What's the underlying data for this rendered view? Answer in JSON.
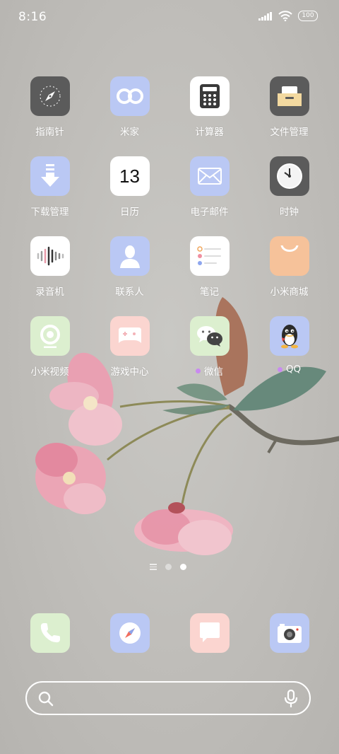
{
  "status_bar": {
    "time": "8:16",
    "battery": "100",
    "icons": [
      "signal-icon",
      "wifi-icon",
      "battery-icon"
    ]
  },
  "apps": [
    {
      "label": "指南针",
      "icon": "compass-icon"
    },
    {
      "label": "米家",
      "icon": "mijia-icon"
    },
    {
      "label": "计算器",
      "icon": "calculator-icon"
    },
    {
      "label": "文件管理",
      "icon": "file-manager-icon"
    },
    {
      "label": "下载管理",
      "icon": "download-icon"
    },
    {
      "label": "日历",
      "icon": "calendar-icon",
      "day": "13"
    },
    {
      "label": "电子邮件",
      "icon": "email-icon"
    },
    {
      "label": "时钟",
      "icon": "clock-icon"
    },
    {
      "label": "录音机",
      "icon": "recorder-icon"
    },
    {
      "label": "联系人",
      "icon": "contacts-icon"
    },
    {
      "label": "笔记",
      "icon": "notes-icon"
    },
    {
      "label": "小米商城",
      "icon": "mi-store-icon"
    },
    {
      "label": "小米视频",
      "icon": "mi-video-icon"
    },
    {
      "label": "游戏中心",
      "icon": "game-center-icon"
    },
    {
      "label": "微信",
      "icon": "wechat-icon",
      "new_dot": true
    },
    {
      "label": "QQ",
      "icon": "qq-icon",
      "new_dot": true
    }
  ],
  "page_indicator": {
    "pages": 2,
    "current": 2
  },
  "dock": [
    {
      "icon": "phone-icon"
    },
    {
      "icon": "browser-icon"
    },
    {
      "icon": "messages-icon"
    },
    {
      "icon": "camera-icon"
    }
  ],
  "search_bar": {
    "icons": [
      "search-icon",
      "mic-icon"
    ]
  },
  "colors": {
    "tile_blue": "#bac8f4",
    "tile_dark": "#5b5b5b",
    "tile_white": "#ffffff",
    "tile_green": "#dcefcf",
    "tile_pink": "#fbd5d0",
    "tile_orange": "#f6c29a",
    "badge_dot": "#c98af0"
  }
}
